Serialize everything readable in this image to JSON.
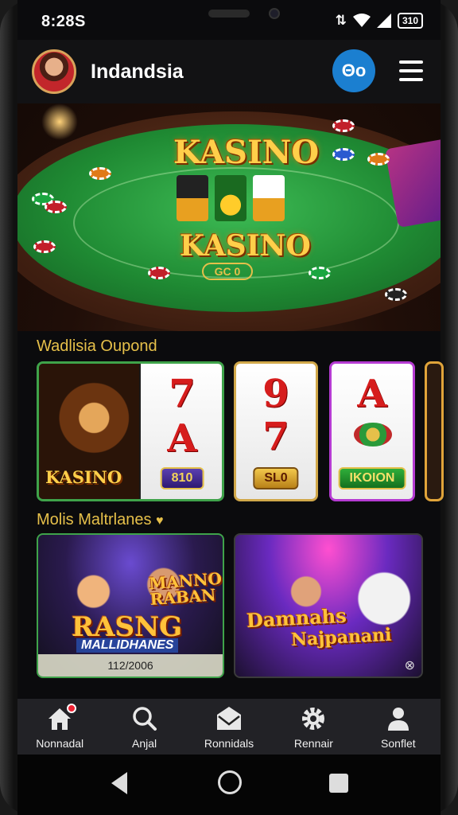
{
  "status_bar": {
    "time": "8:28S",
    "battery": "310"
  },
  "header": {
    "title": "Indandsia",
    "action_button": "Θo"
  },
  "hero": {
    "logo_top": "KASINO",
    "logo_bottom": "KASINO",
    "pot_label": "GC 0"
  },
  "section1": {
    "title": "Wadlisia Oupond",
    "tiles": [
      {
        "logo": "KASINO",
        "reel_top": "7",
        "reel_bottom": "A",
        "label": "810"
      },
      {
        "reel_top": "9",
        "reel_bottom": "7",
        "label": "SL0"
      },
      {
        "reel_top": "A",
        "label": "IKOION"
      }
    ]
  },
  "section2": {
    "title": "Molis Maltrlanes",
    "cards": [
      {
        "badge": "MANNO RABAN",
        "title": "RASNG",
        "subtitle": "MALLIDHANES",
        "footer": "112/2006"
      },
      {
        "title_line1": "Damnahs",
        "title_line2": "Najpanani"
      }
    ]
  },
  "bottom_nav": {
    "items": [
      {
        "label": "Nonnadal",
        "icon": "home-icon"
      },
      {
        "label": "Anjal",
        "icon": "search-icon"
      },
      {
        "label": "Ronnidals",
        "icon": "mail-icon"
      },
      {
        "label": "Rennair",
        "icon": "gear-icon"
      },
      {
        "label": "Sonflet",
        "icon": "user-icon"
      }
    ]
  },
  "colors": {
    "accent": "#1b7fd0",
    "section_title": "#e6c04a",
    "felt": "#1f8a33"
  }
}
